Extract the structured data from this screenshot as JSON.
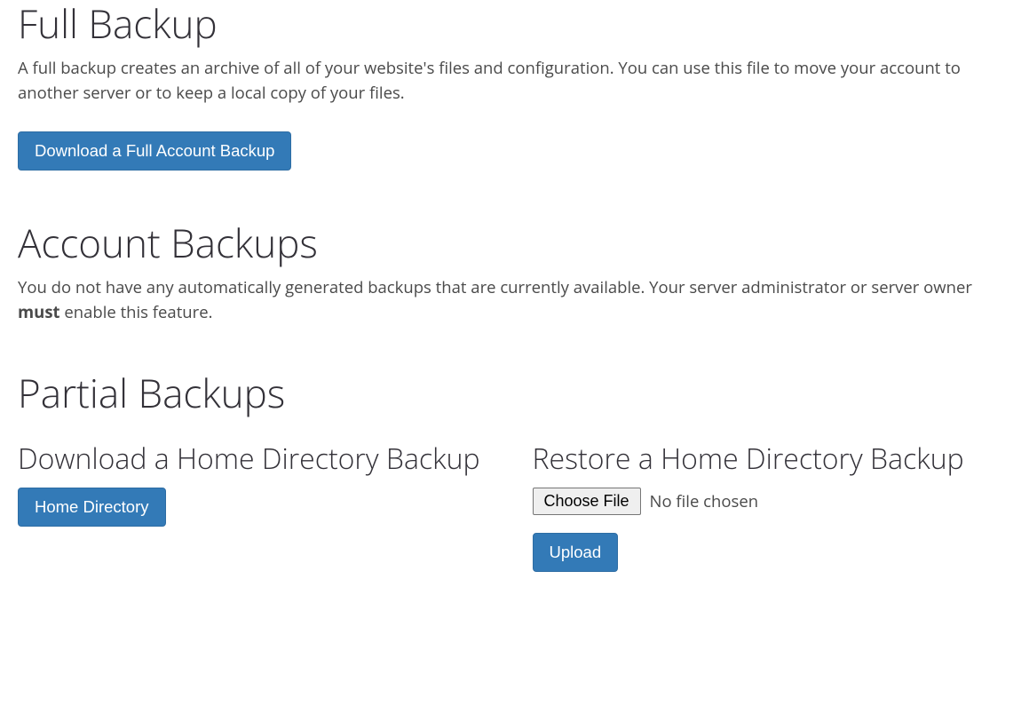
{
  "full_backup": {
    "title": "Full Backup",
    "description": "A full backup creates an archive of all of your website's files and configuration. You can use this file to move your account to another server or to keep a local copy of your files.",
    "button_label": "Download a Full Account Backup"
  },
  "account_backups": {
    "title": "Account Backups",
    "description_pre": "You do not have any automatically generated backups that are currently available. Your server administrator or server owner ",
    "description_bold": "must",
    "description_post": " enable this feature."
  },
  "partial_backups": {
    "title": "Partial Backups",
    "download": {
      "heading": "Download a Home Directory Backup",
      "button_label": "Home Directory"
    },
    "restore": {
      "heading": "Restore a Home Directory Backup",
      "choose_file_label": "Choose File",
      "file_status": "No file chosen",
      "upload_label": "Upload"
    }
  }
}
